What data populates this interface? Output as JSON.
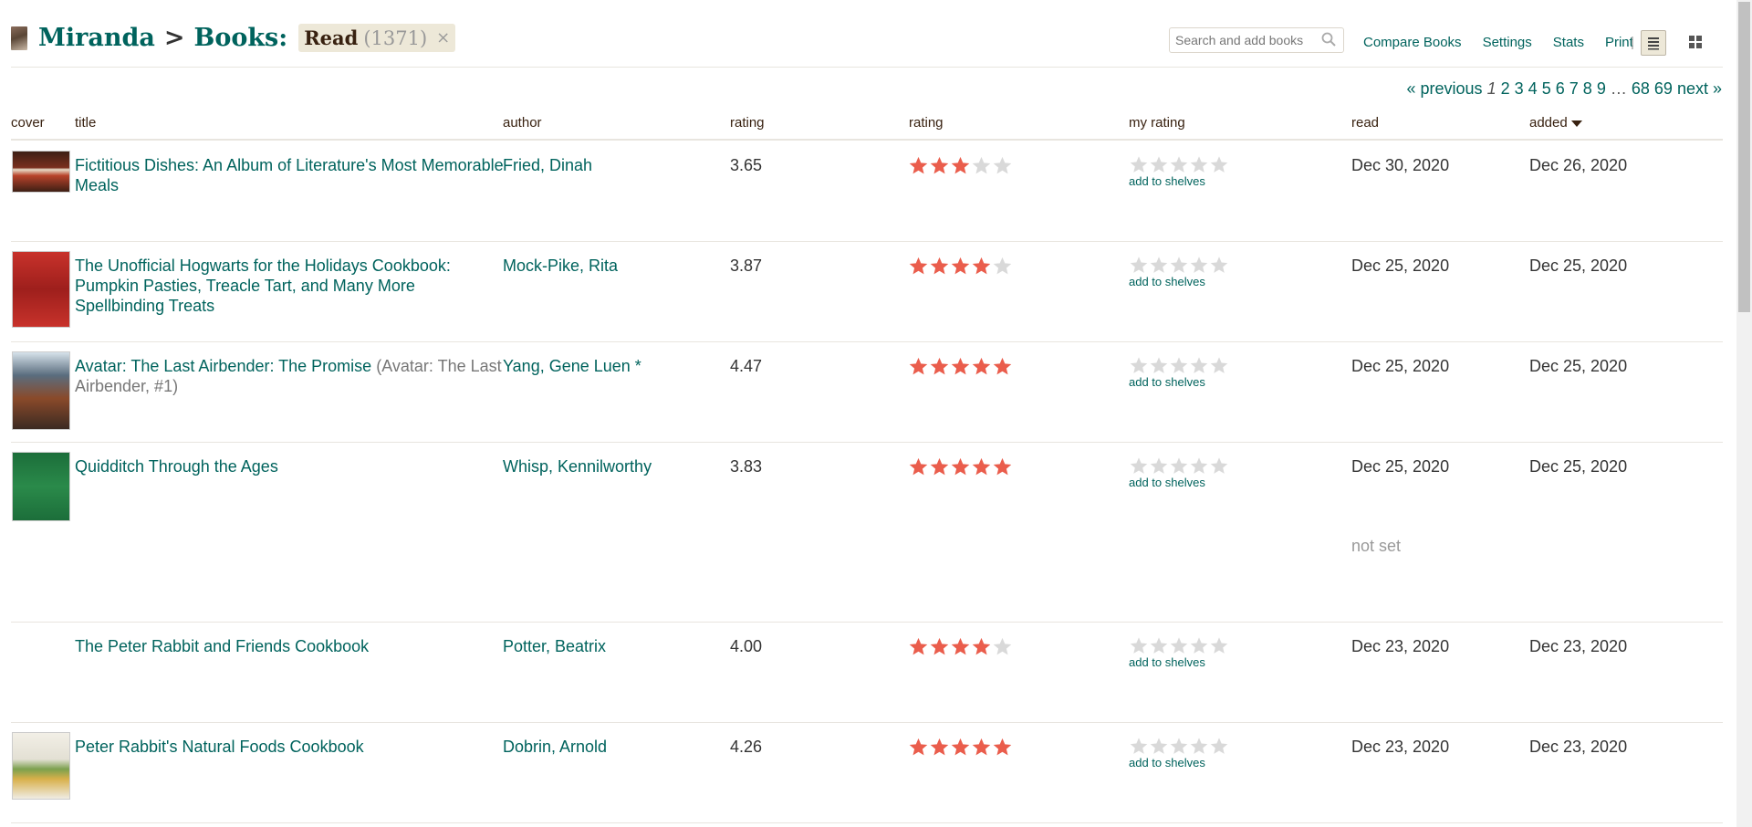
{
  "header": {
    "user": "Miranda",
    "separator": ">",
    "books_label": "Books:",
    "shelf_name": "Read",
    "shelf_count": "(1371)",
    "clear_shelf": "×"
  },
  "search": {
    "placeholder": "Search and add books"
  },
  "toplinks": {
    "compare": "Compare Books",
    "settings": "Settings",
    "stats": "Stats",
    "print": "Print",
    "divider": "|"
  },
  "pager": {
    "previous": "« previous",
    "current": "1",
    "pages": [
      "2",
      "3",
      "4",
      "5",
      "6",
      "7",
      "8",
      "9"
    ],
    "ellipsis": "…",
    "tail_pages": [
      "68",
      "69"
    ],
    "next": "next »"
  },
  "columns": {
    "cover": "cover",
    "title": "title",
    "author": "author",
    "avg_rating": "rating",
    "rating": "rating",
    "my_rating": "my rating",
    "read": "read",
    "added": "added"
  },
  "add_to_shelves": "add to shelves",
  "colors": {
    "accent": "#00635d",
    "star_on": "#ea5d4c",
    "star_off": "#d9d9d9"
  },
  "books": [
    {
      "title": "Fictitious Dishes: An Album of Literature's Most Memorable Meals",
      "series": "",
      "author": "Fried, Dinah",
      "avg_rating": "3.65",
      "stars": 3,
      "read": "Dec 30, 2020",
      "read_extra": "",
      "added": "Dec 26, 2020"
    },
    {
      "title": "The Unofficial Hogwarts for the Holidays Cookbook: Pumpkin Pasties, Treacle Tart, and Many More Spellbinding Treats",
      "series": "",
      "author": "Mock-Pike, Rita",
      "avg_rating": "3.87",
      "stars": 4,
      "read": "Dec 25, 2020",
      "read_extra": "",
      "added": "Dec 25, 2020"
    },
    {
      "title": "Avatar: The Last Airbender: The Promise",
      "series": "(Avatar: The Last Airbender, #1)",
      "author": "Yang, Gene Luen *",
      "avg_rating": "4.47",
      "stars": 5,
      "read": "Dec 25, 2020",
      "read_extra": "",
      "added": "Dec 25, 2020"
    },
    {
      "title": "Quidditch Through the Ages",
      "series": "",
      "author": "Whisp, Kennilworthy",
      "avg_rating": "3.83",
      "stars": 5,
      "read": "Dec 25, 2020",
      "read_extra": "not set",
      "added": "Dec 25, 2020"
    },
    {
      "title": "The Peter Rabbit and Friends Cookbook",
      "series": "",
      "author": "Potter, Beatrix",
      "avg_rating": "4.00",
      "stars": 4,
      "read": "Dec 23, 2020",
      "read_extra": "",
      "added": "Dec 23, 2020"
    },
    {
      "title": "Peter Rabbit's Natural Foods Cookbook",
      "series": "",
      "author": "Dobrin, Arnold",
      "avg_rating": "4.26",
      "stars": 5,
      "read": "Dec 23, 2020",
      "read_extra": "",
      "added": "Dec 23, 2020"
    }
  ]
}
